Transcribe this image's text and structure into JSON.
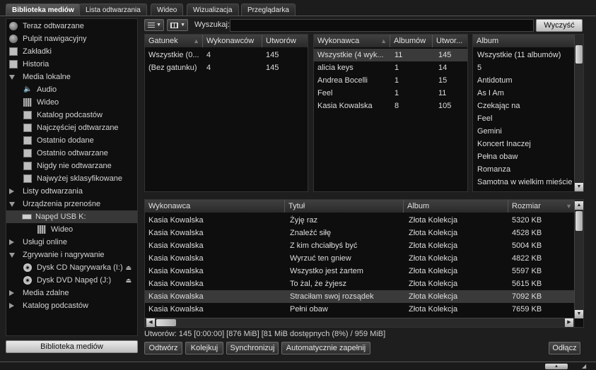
{
  "tabs": [
    {
      "label": "Biblioteka mediów",
      "active": true
    },
    {
      "label": "Lista odtwarzania",
      "active": false
    },
    {
      "label": "Wideo",
      "active": false
    },
    {
      "label": "Wizualizacja",
      "active": false
    },
    {
      "label": "Przeglądarka",
      "active": false
    }
  ],
  "sidebar": {
    "items": [
      {
        "label": "Teraz odtwarzane",
        "icon": "play-circle-icon"
      },
      {
        "label": "Pulpit nawigacyjny",
        "icon": "dashboard-icon"
      },
      {
        "label": "Zakładki",
        "icon": "bookmark-icon"
      },
      {
        "label": "Historia",
        "icon": "history-icon"
      },
      {
        "label": "Media lokalne",
        "icon": "expanded-arrow-icon"
      },
      {
        "label": "Audio",
        "icon": "speaker-icon"
      },
      {
        "label": "Wideo",
        "icon": "film-icon"
      },
      {
        "label": "Katalog podcastów",
        "icon": "podcast-icon"
      },
      {
        "label": "Najczęściej odtwarzane",
        "icon": "smart-playlist-icon"
      },
      {
        "label": "Ostatnio dodane",
        "icon": "smart-playlist-icon"
      },
      {
        "label": "Ostatnio odtwarzane",
        "icon": "smart-playlist-icon"
      },
      {
        "label": "Nigdy nie odtwarzane",
        "icon": "smart-playlist-icon"
      },
      {
        "label": "Najwyżej sklasyfikowane",
        "icon": "smart-playlist-icon"
      },
      {
        "label": "Listy odtwarzania",
        "icon": "collapsed-arrow-icon"
      },
      {
        "label": "Urządzenia przenośne",
        "icon": "expanded-arrow-icon"
      },
      {
        "label": "Napęd USB K:",
        "icon": "usb-drive-icon"
      },
      {
        "label": "Wideo",
        "icon": "film-icon"
      },
      {
        "label": "Usługi online",
        "icon": "collapsed-arrow-icon"
      },
      {
        "label": "Zgrywanie i nagrywanie",
        "icon": "expanded-arrow-icon"
      },
      {
        "label": "Dysk CD Nagrywarka (I:)",
        "icon": "cd-disc-icon"
      },
      {
        "label": "Dysk DVD Napęd (J:)",
        "icon": "dvd-disc-icon"
      },
      {
        "label": "Media zdalne",
        "icon": "collapsed-arrow-icon"
      },
      {
        "label": "Katalog podcastów",
        "icon": "collapsed-arrow-icon"
      }
    ],
    "footer_button": "Biblioteka mediów"
  },
  "toolbar": {
    "search_label": "Wyszukaj:",
    "search_value": "",
    "clear_button": "Wyczyść"
  },
  "genre_pane": {
    "columns": [
      "Gatunek",
      "Wykonawców",
      "Utworów"
    ],
    "rows": [
      [
        "Wszystkie (0...",
        "4",
        "145"
      ],
      [
        "(Bez gatunku)",
        "4",
        "145"
      ]
    ]
  },
  "artist_pane": {
    "columns": [
      "Wykonawca",
      "Albumów",
      "Utwor..."
    ],
    "rows": [
      [
        "Wszystkie (4 wyk...",
        "11",
        "145"
      ],
      [
        "alicia keys",
        "1",
        "14"
      ],
      [
        "Andrea Bocelli",
        "1",
        "15"
      ],
      [
        "Feel",
        "1",
        "11"
      ],
      [
        "Kasia Kowalska",
        "8",
        "105"
      ]
    ]
  },
  "album_pane": {
    "columns": [
      "Album"
    ],
    "rows": [
      "Wszystkie (11 albumów)",
      "5",
      "Antidotum",
      "As I Am",
      "Czekając na",
      "Feel",
      "Gemini",
      "Koncert Inaczej",
      "Pełna obaw",
      "Romanza",
      "Samotna w wielkim mieście"
    ]
  },
  "tracks": {
    "columns": [
      "Wykonawca",
      "Tytuł",
      "Album",
      "Rozmiar"
    ],
    "rows": [
      [
        "Kasia Kowalska",
        "Żyję raz",
        "Złota Kolekcja",
        "5320 KB"
      ],
      [
        "Kasia Kowalska",
        "Znaleźć siłę",
        "Złota Kolekcja",
        "4528 KB"
      ],
      [
        "Kasia Kowalska",
        "Z kim chciałbyś być",
        "Złota Kolekcja",
        "5004 KB"
      ],
      [
        "Kasia Kowalska",
        "Wyrzuć ten gniew",
        "Złota Kolekcja",
        "4822 KB"
      ],
      [
        "Kasia Kowalska",
        "Wszystko jest żartem",
        "Złota Kolekcja",
        "5597 KB"
      ],
      [
        "Kasia Kowalska",
        "To żal, że żyjesz",
        "Złota Kolekcja",
        "5615 KB"
      ],
      [
        "Kasia Kowalska",
        "Straciłam swoj rozsądek",
        "Złota Kolekcja",
        "7092 KB"
      ],
      [
        "Kasia Kowalska",
        "Pełni obaw",
        "Złota Kolekcja",
        "7659 KB"
      ]
    ],
    "selected_index": 6
  },
  "status_text": "Utworów: 145 [0:00:00] [876 MiB] [81 MiB dostępnych (8%) / 959 MiB]",
  "actions": {
    "play": "Odtwórz",
    "enqueue": "Kolejkuj",
    "sync": "Synchronizuj",
    "autofill": "Automatycznie zapełnij",
    "disconnect": "Odłącz"
  }
}
